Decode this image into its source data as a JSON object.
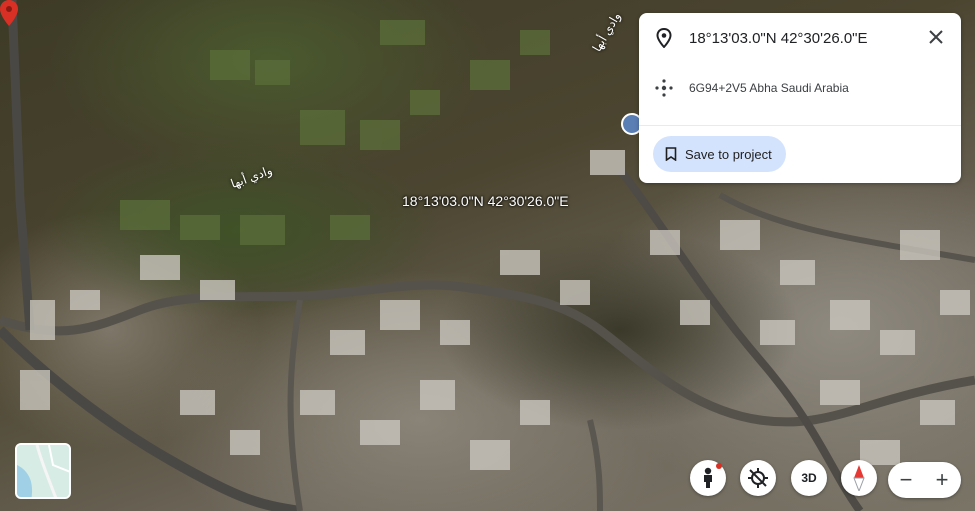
{
  "map": {
    "coordinate_label": "18°13'03.0\"N 42°30'26.0\"E",
    "place_labels": [
      "وادي أبها",
      "وادي أبها"
    ]
  },
  "info_card": {
    "title": "18°13'03.0\"N 42°30'26.0\"E",
    "plus_code": "6G94+2V5 Abha Saudi Arabia",
    "save_label": "Save to project"
  },
  "controls": {
    "three_d_label": "3D",
    "zoom_out": "−",
    "zoom_in": "+"
  },
  "colors": {
    "pin": "#d93025",
    "save_bg": "#d3e3fd",
    "compass_red": "#e53935"
  }
}
